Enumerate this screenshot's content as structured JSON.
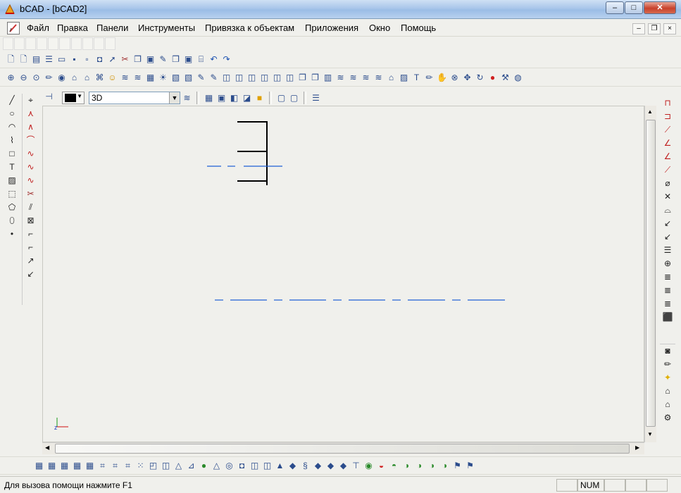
{
  "window": {
    "title": "bCAD - [bCAD2]"
  },
  "window_controls": {
    "minimize": "–",
    "maximize": "□",
    "close": "✕"
  },
  "menu": {
    "items": [
      "Файл",
      "Правка",
      "Панели",
      "Инструменты",
      "Привязка к объектам",
      "Приложения",
      "Окно",
      "Помощь"
    ],
    "mdi_minimize": "–",
    "mdi_restore": "❐",
    "mdi_close": "×"
  },
  "view_toolbar": {
    "mode_value": "3D"
  },
  "status": {
    "help_text": "Для вызова помощи нажмите F1",
    "num_indicator": "NUM"
  },
  "colors": {
    "drawing_line": "#000000",
    "axis_line": "#1f5fd6",
    "current_color": "#000000"
  },
  "icons": {
    "toolbar1": [
      "new-icon",
      "new-icon",
      "print-icon",
      "list-icon",
      "open-icon",
      "save-icon",
      "save-as-icon",
      "save-all-icon",
      "select-icon",
      "cut-icon",
      "copy-icon",
      "paste-icon",
      "brush-icon",
      "copy-icon",
      "paste-icon",
      "stamp-icon",
      "undo-icon",
      "redo-icon"
    ],
    "toolbar2": [
      "zoom-in-icon",
      "zoom-out-icon",
      "zoom-window-icon",
      "pencil-icon",
      "eye-icon",
      "hat-icon",
      "hat-icon",
      "tree-icon",
      "smiley-icon",
      "layers-icon",
      "layers-icon",
      "grid-icon",
      "light-icon",
      "picture-icon",
      "picture-icon",
      "brush-icon",
      "brush-icon",
      "cube-icon",
      "cube-icon",
      "cube-icon",
      "cube-icon",
      "cube-icon",
      "cube-icon",
      "copy-icon",
      "copy-icon",
      "window-icon",
      "layers-icon",
      "layers-icon",
      "layers-icon",
      "layers-icon",
      "hat-icon",
      "hatch-icon",
      "text-icon",
      "pencil-icon",
      "hand-icon",
      "zoom-icon",
      "move-icon",
      "rotate-icon",
      "stop-icon",
      "hammer-icon",
      "globe-icon"
    ],
    "left_draw": [
      "line-icon",
      "circle-icon",
      "arc-icon",
      "polyline-icon",
      "rectangle-icon",
      "text-icon",
      "hatch-icon",
      "region-icon",
      "polygon-icon",
      "ellipse-icon",
      "point-icon"
    ],
    "left_edit": [
      "edit-icon",
      "chamfer-icon",
      "corner-icon",
      "arc-edit-icon",
      "wave-icon",
      "wave-icon",
      "wave-icon",
      "cut-icon",
      "offset-icon",
      "boolean-icon",
      "fillet-icon",
      "fillet-r-icon",
      "extend-icon",
      "trim-icon"
    ],
    "right_dim": [
      "dim-horizontal-icon",
      "dim-vertical-icon",
      "dim-aligned-icon",
      "dim-angle-icon",
      "dim-angle-icon",
      "dim-linear-icon",
      "dim-diameter-icon",
      "dim-radius-icon",
      "dim-arc-icon",
      "dim-leader-icon",
      "dim-leader-icon",
      "list-icon",
      "coords-icon",
      "stack-icon",
      "stack-icon",
      "stack-icon",
      "box-icon"
    ],
    "right_render": [
      "camera-icon",
      "pencil-icon",
      "lightbulb-icon",
      "house-icon",
      "house-icon",
      "settings-icon"
    ],
    "bottom": [
      "grid-icon",
      "grid-icon",
      "grid-icon",
      "grid-icon",
      "grid-icon",
      "snap-icon",
      "snap-icon",
      "snap-icon",
      "dots-icon",
      "layout-icon",
      "cube-icon",
      "cone-icon",
      "tool-icon",
      "sphere-icon",
      "cone-icon",
      "torus-icon",
      "tube-icon",
      "cube-icon",
      "cube-icon",
      "pyramid-icon",
      "shape-icon",
      "spring-icon",
      "shape-icon",
      "shape-icon",
      "shape-icon",
      "pipe-icon",
      "bool-union-icon",
      "bool-sub-icon",
      "bool-int-icon",
      "bool-icon",
      "bool-icon",
      "bool-icon",
      "bool-icon",
      "flag-icon",
      "flag-icon"
    ]
  }
}
